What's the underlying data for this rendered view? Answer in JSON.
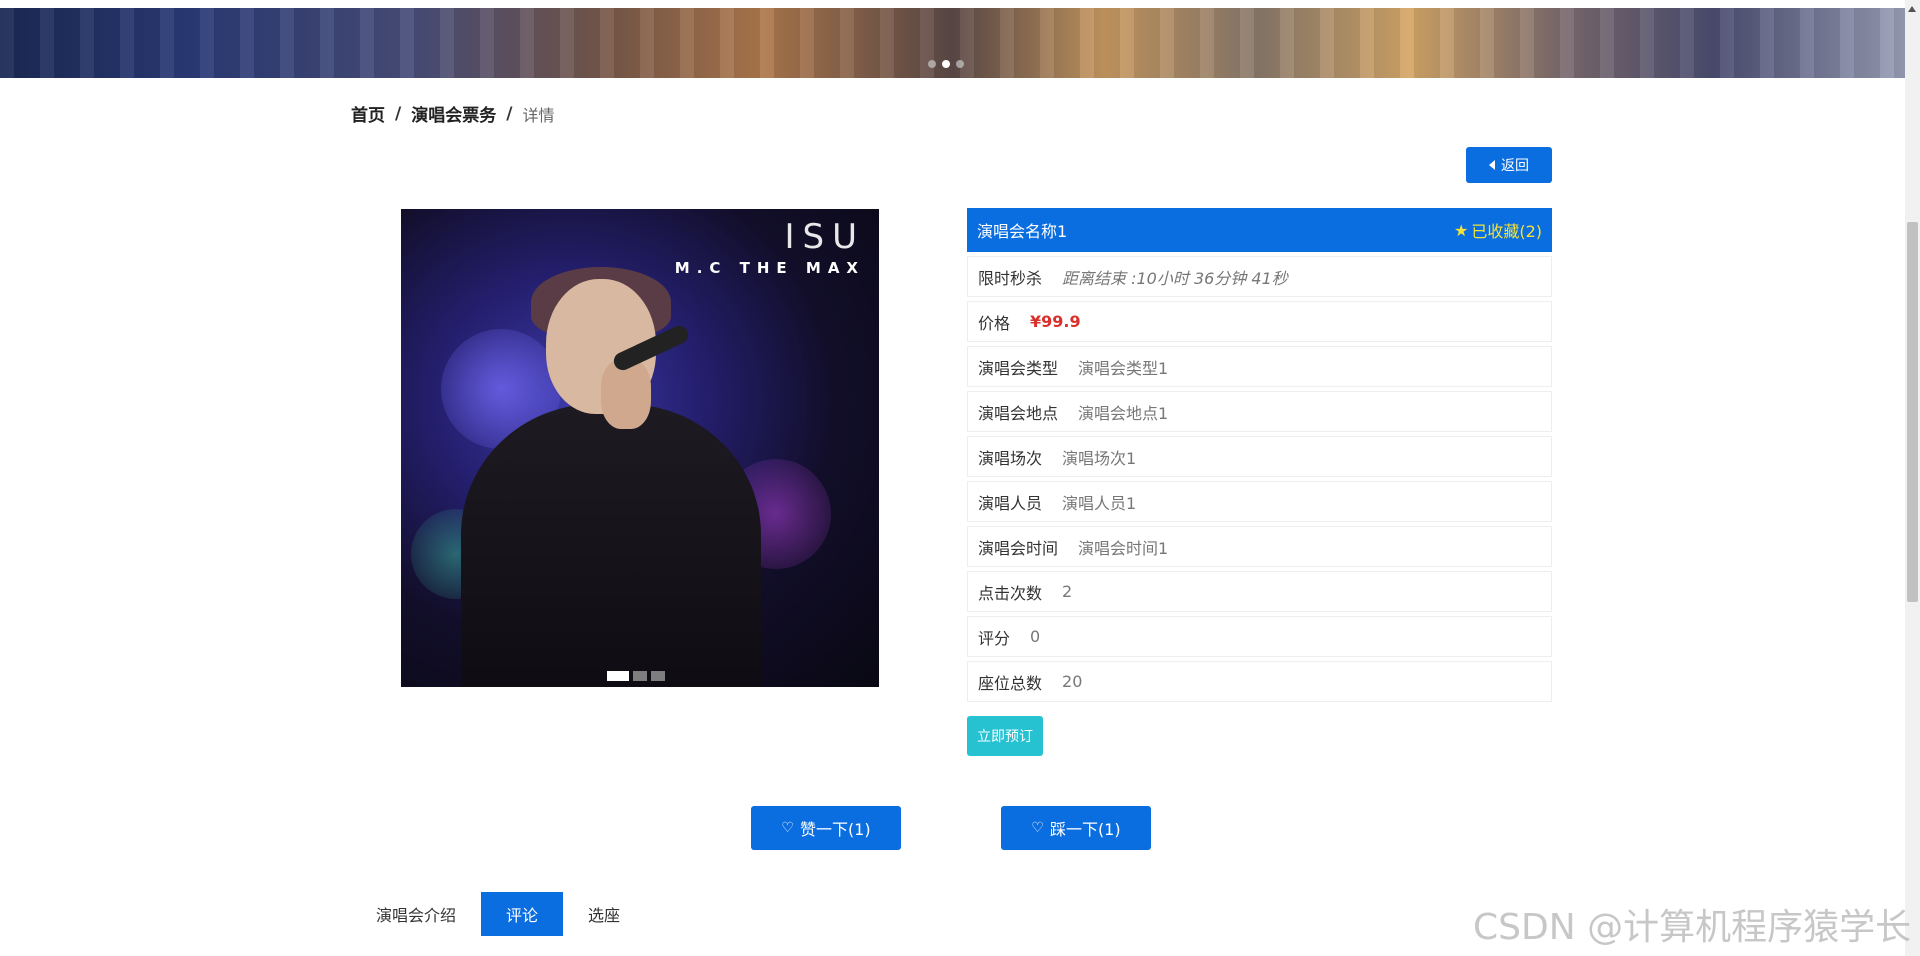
{
  "breadcrumb": {
    "home": "首页",
    "section": "演唱会票务",
    "current": "详情",
    "separator": "/"
  },
  "back_button": {
    "label": "返回"
  },
  "product_image": {
    "logo_text": "ISU",
    "sub_text": "M.C THE MAX"
  },
  "detail": {
    "title": "演唱会名称1",
    "favorite_label": "已收藏(2)",
    "rows": [
      {
        "label": "限时秒杀",
        "value": "距离结束 :10小时 36分钟 41秒"
      },
      {
        "label": "价格",
        "value": "¥99.9"
      },
      {
        "label": "演唱会类型",
        "value": "演唱会类型1"
      },
      {
        "label": "演唱会地点",
        "value": "演唱会地点1"
      },
      {
        "label": "演唱场次",
        "value": "演唱场次1"
      },
      {
        "label": "演唱人员",
        "value": "演唱人员1"
      },
      {
        "label": "演唱会时间",
        "value": "演唱会时间1"
      },
      {
        "label": "点击次数",
        "value": "2"
      },
      {
        "label": "评分",
        "value": "0"
      },
      {
        "label": "座位总数",
        "value": "20"
      }
    ]
  },
  "book_button": {
    "label": "立即预订"
  },
  "votes": {
    "like_label": "赞一下(1)",
    "dislike_label": "踩一下(1)"
  },
  "tabs": [
    {
      "label": "演唱会介绍",
      "active": false
    },
    {
      "label": "评论",
      "active": true
    },
    {
      "label": "选座",
      "active": false
    }
  ],
  "watermark": "CSDN @计算机程序猿学长",
  "colors": {
    "primary": "#0a6de0",
    "price": "#d9302c",
    "favorite": "#f2e23a",
    "book": "#26c2d2"
  }
}
